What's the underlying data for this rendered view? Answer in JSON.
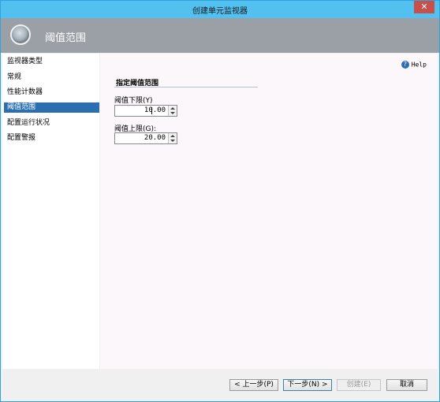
{
  "window": {
    "title": "创建单元监视器",
    "close_glyph": "✕"
  },
  "header": {
    "title": "阈值范围"
  },
  "sidebar": {
    "items": [
      {
        "label": "监视器类型"
      },
      {
        "label": "常规"
      },
      {
        "label": "性能计数器"
      },
      {
        "label": "阈值范围",
        "active": true
      },
      {
        "label": "配置运行状况"
      },
      {
        "label": "配置警报"
      }
    ]
  },
  "main": {
    "help_label": "Help",
    "help_icon": "?",
    "section_title": "指定阈值范围",
    "lower": {
      "label": "阈值下限(Y)",
      "value": "10.00"
    },
    "upper": {
      "label": "阈值上限(G):",
      "value": "20.00"
    }
  },
  "footer": {
    "prev_label": "< 上一步(P)",
    "next_label": "下一步(N) >",
    "create_label": "创建(E)",
    "cancel_label": "取消"
  },
  "colors": {
    "titlebar": "#52c1f0",
    "header": "#9aa0a6",
    "active_nav": "#2c6fb0",
    "close_button": "#c7504a"
  }
}
